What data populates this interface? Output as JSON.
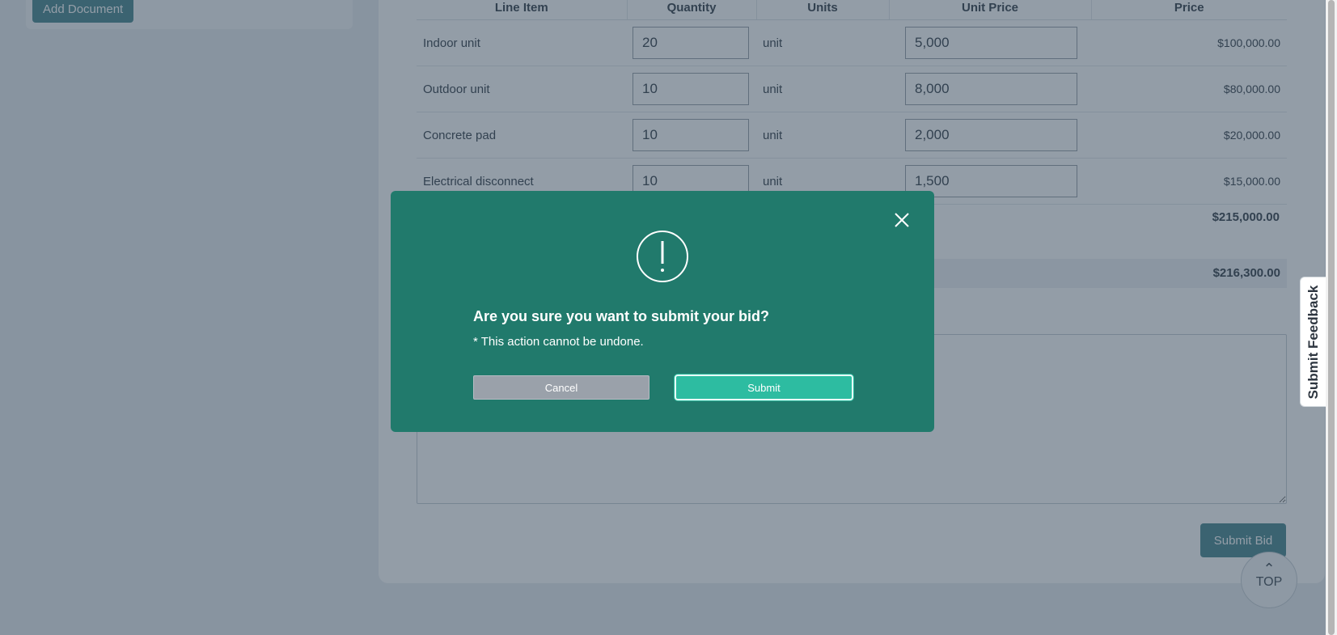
{
  "documents": {
    "add_label": "Add Document"
  },
  "table": {
    "headers": [
      "Line Item",
      "Quantity",
      "Units",
      "Unit Price",
      "Price"
    ],
    "rows": [
      {
        "item": "Indoor unit",
        "qty": "20",
        "units": "unit",
        "unit_price": "5,000",
        "price": "$100,000.00"
      },
      {
        "item": "Outdoor unit",
        "qty": "10",
        "units": "unit",
        "unit_price": "8,000",
        "price": "$80,000.00"
      },
      {
        "item": "Concrete pad",
        "qty": "10",
        "units": "unit",
        "unit_price": "2,000",
        "price": "$20,000.00"
      },
      {
        "item": "Electrical disconnect",
        "qty": "10",
        "units": "unit",
        "unit_price": "1,500",
        "price": "$15,000.00"
      }
    ],
    "subtotal": "$215,000.00",
    "total": "$216,300.00"
  },
  "actions": {
    "submit_bid_label": "Submit Bid",
    "top_label": "TOP"
  },
  "feedback": {
    "label": "Submit Feedback"
  },
  "modal": {
    "title": "Are you sure you want to submit your bid?",
    "subtitle": "* This action cannot be undone.",
    "cancel_label": "Cancel",
    "submit_label": "Submit",
    "icon": "exclamation-circle-icon",
    "close_icon": "close-icon"
  },
  "colors": {
    "modal_bg": "#217a6c",
    "submit_accent": "#2dbca1",
    "primary": "#4f8b93"
  }
}
